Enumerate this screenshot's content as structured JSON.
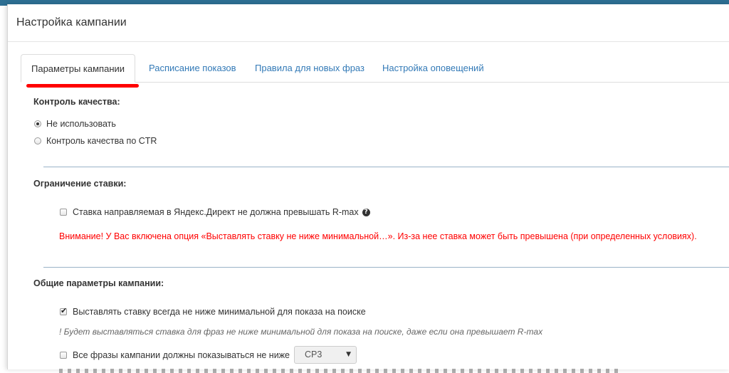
{
  "modal": {
    "title": "Настройка кампании"
  },
  "tabs": [
    {
      "label": "Параметры кампании",
      "active": true
    },
    {
      "label": "Расписание показов",
      "active": false
    },
    {
      "label": "Правила для новых фраз",
      "active": false
    },
    {
      "label": "Настройка оповещений",
      "active": false
    }
  ],
  "quality": {
    "title": "Контроль качества:",
    "options": [
      {
        "label": "Не использовать",
        "checked": true
      },
      {
        "label": "Контроль качества по CTR",
        "checked": false
      }
    ]
  },
  "bid_limit": {
    "title": "Ограничение ставки:",
    "checkbox_label": "Ставка направляемая в Яндекс.Директ не должна превышать R-max",
    "checked": false,
    "help_icon": "question-circle-icon",
    "warning": "Внимание! У Вас включена опция «Выставлять ставку не ниже минимальной…». Из-за нее ставка может быть превышена (при определенных условиях)."
  },
  "general": {
    "title": "Общие параметры кампании:",
    "min_bid_label": "Выставлять ставку всегда не ниже минимальной для показа на поиске",
    "min_bid_checked": true,
    "min_bid_note": "! Будет выставляться ставка для фраз не ниже минимальной для показа на поиске, даже если она превышает R-max",
    "position_label": "Все фразы кампании должны показываться не ниже",
    "position_checked": false,
    "position_select": "СР3"
  },
  "colors": {
    "accent": "#337ab7",
    "warning": "#ff0000",
    "topbar": "#2d6f93"
  }
}
